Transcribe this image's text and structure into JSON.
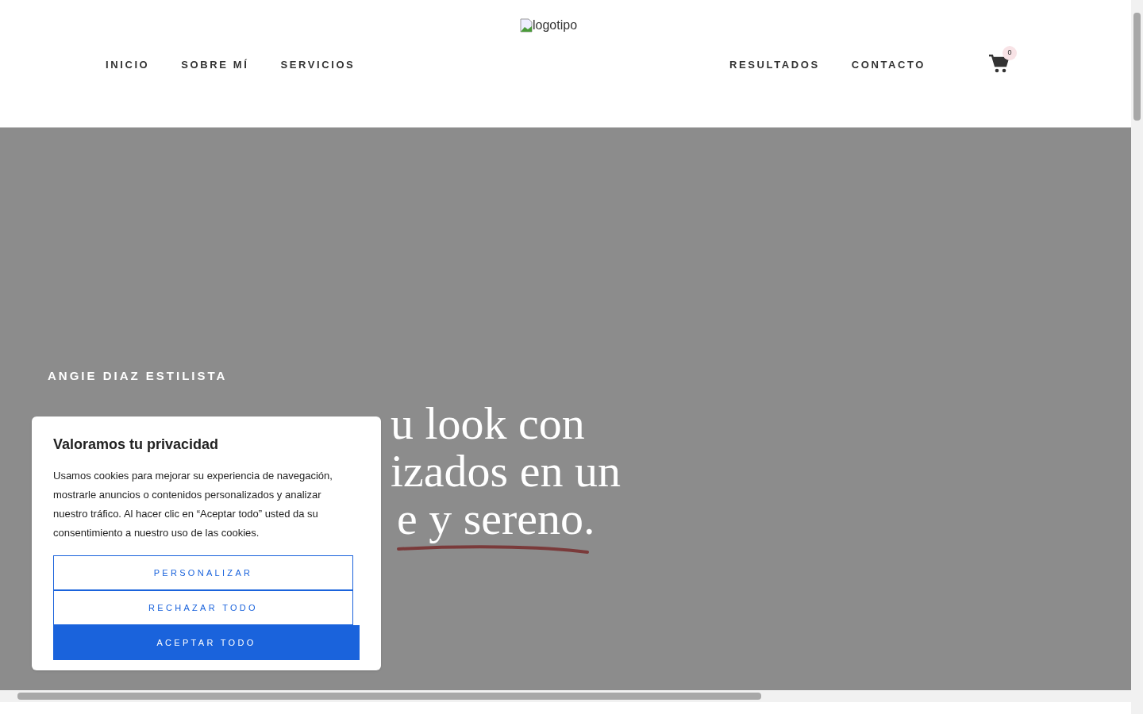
{
  "header": {
    "logo_alt": "logotipo",
    "nav_left": [
      "INICIO",
      "SOBRE MÍ",
      "SERVICIOS"
    ],
    "nav_right": [
      "RESULTADOS",
      "CONTACTO"
    ],
    "cart_count": "0"
  },
  "hero": {
    "eyebrow": "ANGIE DIAZ ESTILISTA",
    "headline_fragments": [
      "u look con",
      "izados en un",
      "e y sereno."
    ]
  },
  "cookie_banner": {
    "title": "Valoramos tu privacidad",
    "body": "Usamos cookies para mejorar su experiencia de navegación, mostrarle anuncios o contenidos personalizados y analizar nuestro tráfico. Al hacer clic en “Aceptar todo” usted da su consentimiento a nuestro uso de las cookies.",
    "buttons": [
      {
        "label": "PERSONALIZAR",
        "kind": "outline"
      },
      {
        "label": "RECHAZAR TODO",
        "kind": "outline"
      },
      {
        "label": "ACEPTAR TODO",
        "kind": "primary"
      }
    ]
  }
}
